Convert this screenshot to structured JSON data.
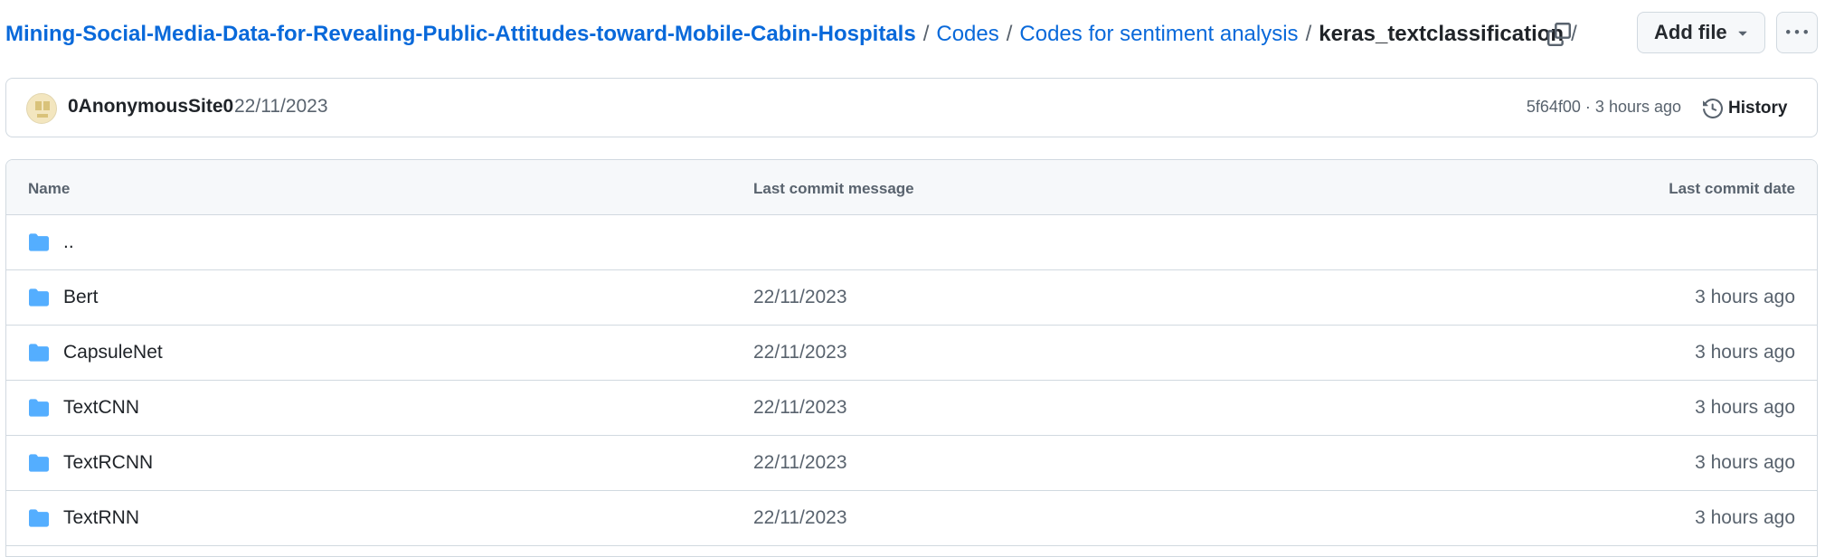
{
  "breadcrumb": {
    "repo": "Mining-Social-Media-Data-for-Revealing-Public-Attitudes-toward-Mobile-Cabin-Hospitals",
    "seg1": "Codes",
    "seg2": "Codes for sentiment analysis",
    "current": "keras_textclassification",
    "sep": "/"
  },
  "toolbar": {
    "add_file_label": "Add file"
  },
  "commit": {
    "author": "0AnonymousSite0",
    "date": "22/11/2023",
    "meta": "5f64f00 · 3 hours ago",
    "history_label": "History"
  },
  "table": {
    "headers": {
      "name": "Name",
      "message": "Last commit message",
      "date": "Last commit date"
    },
    "parent": {
      "name": ".."
    },
    "rows": [
      {
        "name": "Bert",
        "message": "22/11/2023",
        "date": "3 hours ago"
      },
      {
        "name": "CapsuleNet",
        "message": "22/11/2023",
        "date": "3 hours ago"
      },
      {
        "name": "TextCNN",
        "message": "22/11/2023",
        "date": "3 hours ago"
      },
      {
        "name": "TextRCNN",
        "message": "22/11/2023",
        "date": "3 hours ago"
      },
      {
        "name": "TextRNN",
        "message": "22/11/2023",
        "date": "3 hours ago"
      }
    ]
  },
  "colors": {
    "link": "#0969da",
    "folder": "#54aeff",
    "muted": "#59636e",
    "border": "#d1d9e0"
  }
}
